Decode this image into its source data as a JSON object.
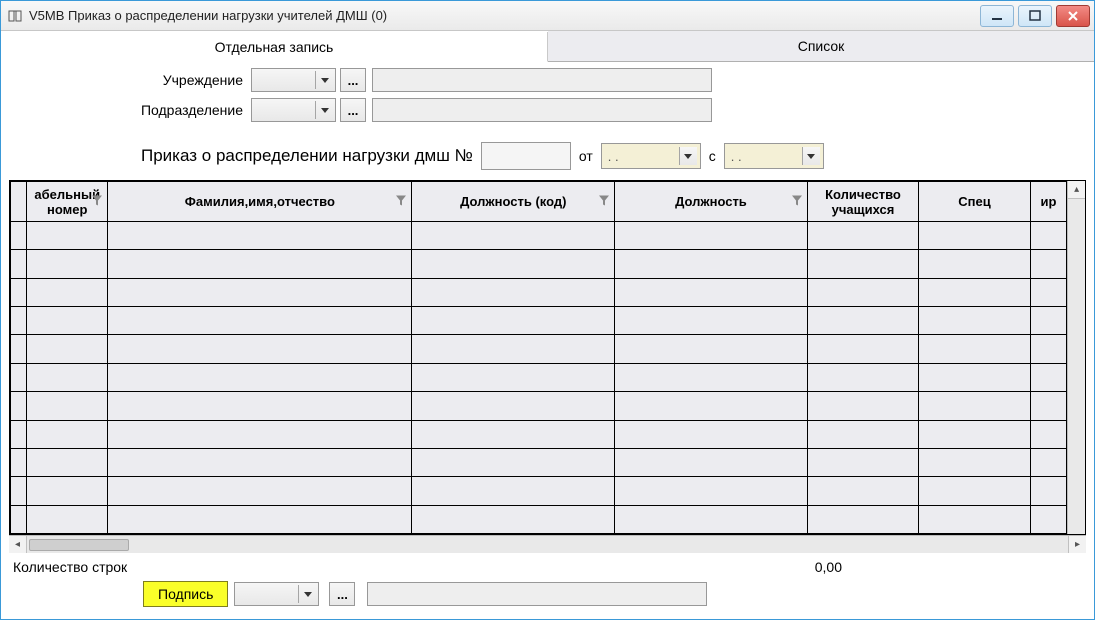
{
  "window": {
    "title": "V5MB Приказ о распределении нагрузки учителей ДМШ (0)"
  },
  "tabs": {
    "record": "Отдельная запись",
    "list": "Список",
    "active": "record"
  },
  "form": {
    "institution_label": "Учреждение",
    "institution_value": "",
    "institution_text": "",
    "department_label": "Подразделение",
    "department_value": "",
    "department_text": ""
  },
  "order": {
    "prefix": "Приказ о распределении нагрузки дмш №",
    "number": "",
    "from_label": "от",
    "date_from": " .  .",
    "s_label": "с",
    "date_s": " .  ."
  },
  "grid": {
    "columns": [
      {
        "label": "абельный номер",
        "filter": true
      },
      {
        "label": "Фамилия,имя,отчество",
        "filter": true
      },
      {
        "label": "Должность (код)",
        "filter": true
      },
      {
        "label": "Должность",
        "filter": true
      },
      {
        "label": "Количество учащихся",
        "filter": false
      },
      {
        "label": "Спец",
        "filter": false
      },
      {
        "label": "ир",
        "filter": false
      }
    ],
    "rows": 11
  },
  "footer": {
    "rowcount_label": "Количество строк",
    "rowcount_value": "0,00",
    "sign_label": "Подпись",
    "sign_combo": "",
    "sign_text": ""
  },
  "icons": {
    "ellipsis": "..."
  }
}
